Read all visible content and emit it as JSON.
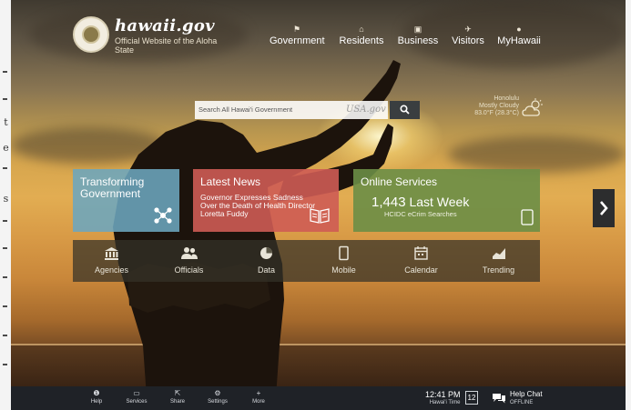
{
  "header": {
    "site_name": "hawaii.gov",
    "tagline": "Official Website of the Aloha State"
  },
  "nav": [
    {
      "label": "Government",
      "icon": "flag-icon"
    },
    {
      "label": "Residents",
      "icon": "home-icon"
    },
    {
      "label": "Business",
      "icon": "briefcase-icon"
    },
    {
      "label": "Visitors",
      "icon": "plane-icon"
    },
    {
      "label": "MyHawaii",
      "icon": "user-icon"
    }
  ],
  "search": {
    "placeholder": "Search All Hawai'i Government",
    "hint": "USA.gov",
    "button_icon": "search-icon"
  },
  "weather": {
    "line1": "Honolulu",
    "line2": "Mostly Cloudy",
    "line3": "83.0°F (28.3°C)",
    "icon": "cloud-sun-icon"
  },
  "tiles": {
    "transforming": {
      "title_line1": "Transforming",
      "title_line2": "Government",
      "icon": "network-icon"
    },
    "news": {
      "title": "Latest News",
      "line1": "Governor Expresses Sadness",
      "line2": "Over the Death of Health Director",
      "line3": "Loretta Fuddy",
      "icon": "newspaper-icon"
    },
    "online": {
      "title": "Online Services",
      "count": "1,443",
      "period": "Last Week",
      "subtitle": "HCIDC eCrim Searches",
      "icon": "tablet-icon"
    }
  },
  "quicklinks": [
    {
      "label": "Agencies",
      "icon": "building-icon"
    },
    {
      "label": "Officials",
      "icon": "people-icon"
    },
    {
      "label": "Data",
      "icon": "pie-chart-icon"
    },
    {
      "label": "Mobile",
      "icon": "mobile-icon"
    },
    {
      "label": "Calendar",
      "icon": "calendar-icon"
    },
    {
      "label": "Trending",
      "icon": "trending-icon"
    }
  ],
  "bottom_bar": {
    "items": [
      {
        "label": "Help",
        "icon": "info-icon",
        "glyph": "❶"
      },
      {
        "label": "Services",
        "icon": "laptop-icon",
        "glyph": "▭"
      },
      {
        "label": "Share",
        "icon": "share-icon",
        "glyph": "⇱"
      },
      {
        "label": "Settings",
        "icon": "gear-icon",
        "glyph": "⚙"
      },
      {
        "label": "More",
        "icon": "plus-icon",
        "glyph": "+"
      }
    ],
    "time": "12:41 PM",
    "time_zone": "Hawai'i Time",
    "date_day": "12",
    "chat_title": "Help Chat",
    "chat_status": "OFFLINE"
  },
  "page_margin": {
    "letters": [
      "t",
      "e",
      "s"
    ]
  }
}
